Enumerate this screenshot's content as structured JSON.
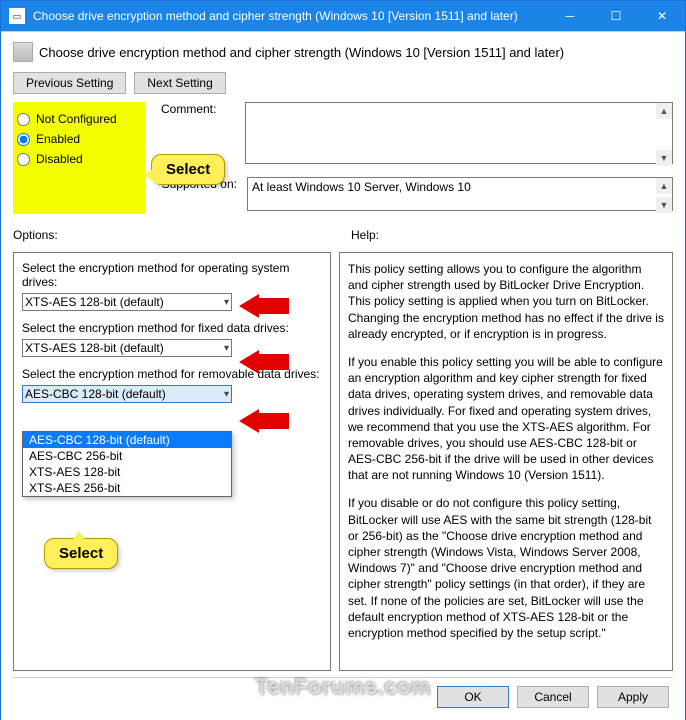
{
  "titlebar": {
    "title": "Choose drive encryption method and cipher strength (Windows 10 [Version 1511] and later)"
  },
  "header": {
    "title": "Choose drive encryption method and cipher strength (Windows 10 [Version 1511] and later)"
  },
  "nav": {
    "prev": "Previous Setting",
    "next": "Next Setting"
  },
  "radios": {
    "not_configured": "Not Configured",
    "enabled": "Enabled",
    "disabled": "Disabled",
    "selected": "enabled"
  },
  "labels": {
    "comment": "Comment:",
    "supported": "Supported on:",
    "options": "Options:",
    "help": "Help:"
  },
  "supported_text": "At least Windows 10 Server, Windows 10",
  "callouts": {
    "select1": "Select",
    "select2": "Select"
  },
  "options": {
    "q1": "Select the encryption method for operating system drives:",
    "sel1": "XTS-AES 128-bit (default)",
    "q2": "Select the encryption method for fixed data drives:",
    "sel2": "XTS-AES 128-bit (default)",
    "q3": "Select the encryption method for removable data drives:",
    "sel3": "AES-CBC 128-bit  (default)",
    "dropdown": [
      "AES-CBC 128-bit  (default)",
      "AES-CBC 256-bit",
      "XTS-AES 128-bit",
      "XTS-AES 256-bit"
    ]
  },
  "help": {
    "p1": "This policy setting allows you to configure the algorithm and cipher strength used by BitLocker Drive Encryption. This policy setting is applied when you turn on BitLocker. Changing the encryption method has no effect if the drive is already encrypted, or if encryption is in progress.",
    "p2": "If you enable this policy setting you will be able to configure an encryption algorithm and key cipher strength for fixed data drives, operating system drives, and removable data drives individually. For fixed and operating system drives, we recommend that you use the XTS-AES algorithm. For removable drives, you should use AES-CBC 128-bit or AES-CBC 256-bit if the drive will be used in other devices that are not running Windows 10 (Version 1511).",
    "p3": "If you disable or do not configure this policy setting, BitLocker will use AES with the same bit strength (128-bit or 256-bit) as the \"Choose drive encryption method and cipher strength (Windows Vista, Windows Server 2008, Windows 7)\" and \"Choose drive encryption method and cipher strength\" policy settings (in that order), if they are set. If none of the policies are set, BitLocker will use the default encryption method of XTS-AES 128-bit or the encryption method specified by the setup script.\""
  },
  "footer": {
    "ok": "OK",
    "cancel": "Cancel",
    "apply": "Apply"
  },
  "watermark": "TenForums.com"
}
